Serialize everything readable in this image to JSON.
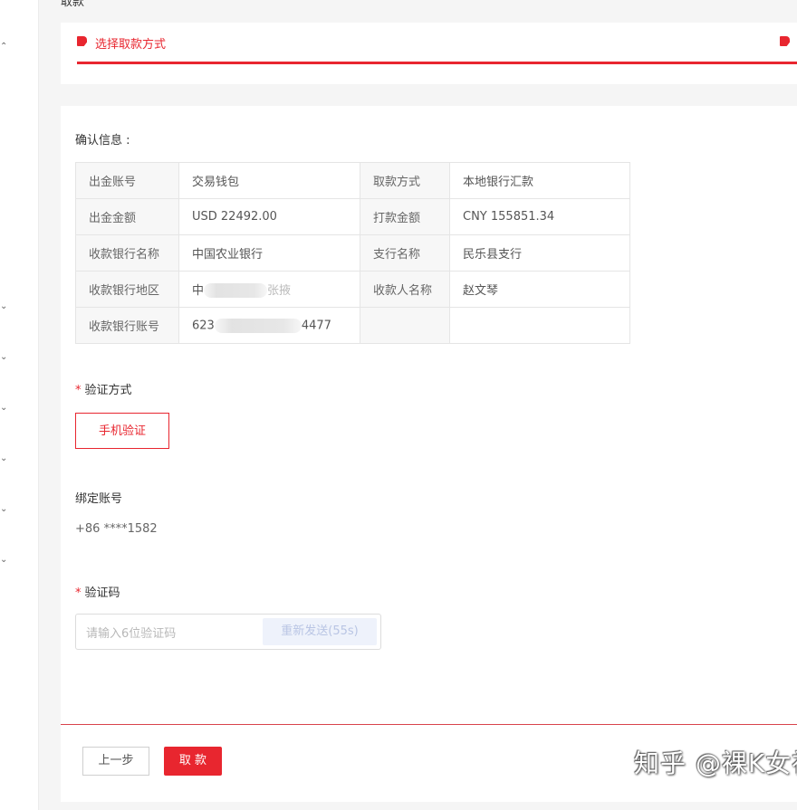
{
  "page": {
    "header_cut": "取款"
  },
  "steps": {
    "current_label": "选择取款方式"
  },
  "confirm": {
    "title": "确认信息 :",
    "rows": [
      {
        "l1": "出金账号",
        "v1": "交易钱包",
        "l2": "取款方式",
        "v2": "本地银行汇款"
      },
      {
        "l1": "出金金额",
        "v1": "USD 22492.00",
        "l2": "打款金额",
        "v2": "CNY 155851.34"
      },
      {
        "l1": "收款银行名称",
        "v1": "中国农业银行",
        "l2": "支行名称",
        "v2": "民乐县支行"
      },
      {
        "l1": "收款银行地区",
        "v1_pre": "中",
        "v1_post": "张掖",
        "l2": "收款人名称",
        "v2": "赵文琴"
      },
      {
        "l1": "收款银行账号",
        "v1_pre": "623",
        "v1_post": "4477",
        "l2": "",
        "v2": ""
      }
    ]
  },
  "verify": {
    "label": "验证方式",
    "required_mark": "*",
    "option": "手机验证"
  },
  "bound": {
    "label": "绑定账号",
    "value": "+86 ****1582"
  },
  "code": {
    "label": "验证码",
    "required_mark": "*",
    "placeholder": "请输入6位验证码",
    "resend": "重新发送(55s)"
  },
  "actions": {
    "prev": "上一步",
    "submit": "取 款"
  },
  "watermark": "知乎 @裸K女神",
  "colors": {
    "accent": "#e8262f",
    "resend_bg": "#eef2fb"
  }
}
